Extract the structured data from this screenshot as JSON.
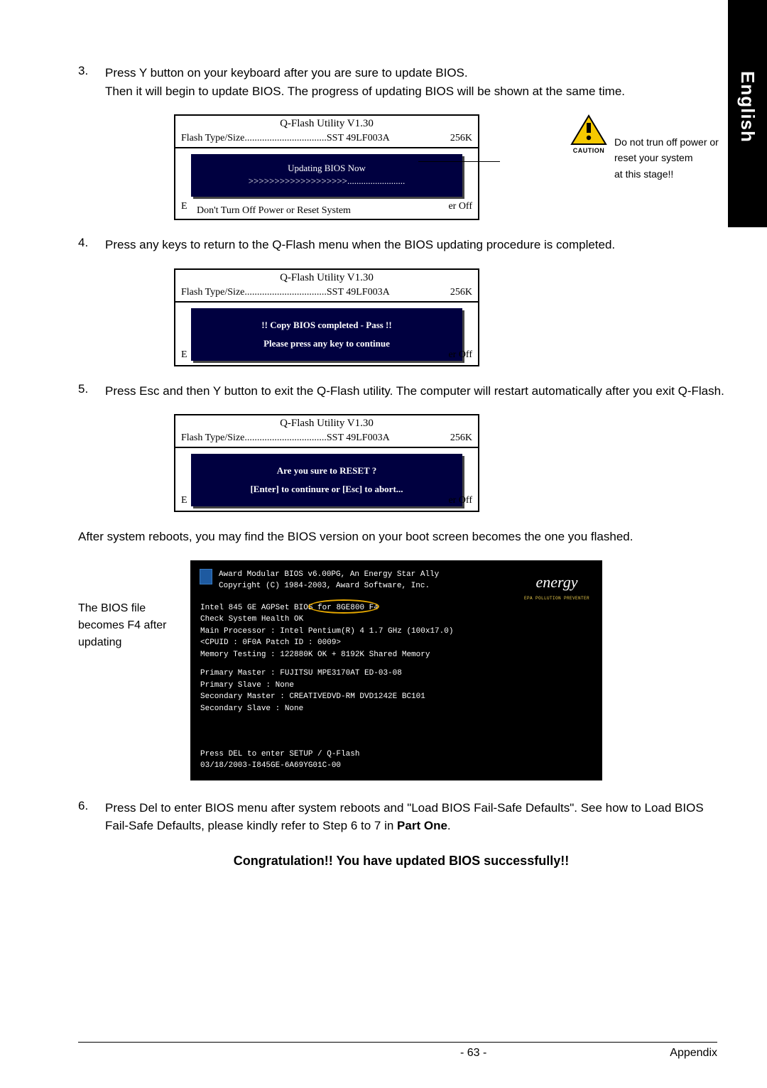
{
  "sidebar": {
    "language": "English"
  },
  "steps": {
    "s3": {
      "num": "3.",
      "text1": "Press Y button on your keyboard after you are sure to update BIOS.",
      "text2": "Then it will begin to update BIOS. The progress of updating BIOS will be shown at the same time."
    },
    "s4": {
      "num": "4.",
      "text": "Press any keys to return to the Q-Flash menu when the BIOS updating procedure is completed."
    },
    "s5": {
      "num": "5.",
      "text": "Press Esc and then Y button to exit the Q-Flash utility. The computer will restart automatically after you exit Q-Flash."
    },
    "s6": {
      "num": "6.",
      "text": "Press Del to enter BIOS menu after system reboots and \"Load BIOS Fail-Safe Defaults\". See how to Load BIOS Fail-Safe Defaults, please kindly refer to Step 6 to 7 in Part One."
    }
  },
  "qflash": {
    "title": "Q-Flash Utility V1.30",
    "flash_label": "Flash Type/Size.................................SST 49LF003A",
    "size": "256K",
    "footer_left": "E",
    "footer_right": "er Off",
    "box1": {
      "line1": "Updating BIOS Now",
      "line2": ">>>>>>>>>>>>>>>>>>>.........................",
      "footer_full": "Don't Turn Off Power or Reset System"
    },
    "box2": {
      "line1": "!! Copy BIOS completed - Pass !!",
      "line2": "Please press any key to continue"
    },
    "box3": {
      "line1": "Are you sure to RESET ?",
      "line2": "[Enter] to continure or [Esc] to abort..."
    }
  },
  "caution": {
    "label": "CAUTION",
    "note1": "Do not trun off power or",
    "note2": "reset your system",
    "note3": "at this stage!!"
  },
  "after_reboot": "After system reboots, you may find the BIOS version on your boot screen becomes the one you flashed.",
  "boot_label": "The BIOS file becomes F4 after updating",
  "boot": {
    "l1": "Award Modular BIOS v6.00PG, An Energy Star Ally",
    "l2": "Copyright (C) 1984-2003, Award Software, Inc.",
    "l3a": "Intel 845 GE AGPSet BIOS",
    "l3b": "for 8GE800 F4",
    "l4": "Check System Health OK",
    "l5": "Main Processor : Intel Pentium(R) 4  1.7 GHz (100x17.0)",
    "l6": "<CPUID : 0F0A Patch ID : 0009>",
    "l7": "Memory Testing  : 122880K OK + 8192K Shared Memory",
    "l8": "Primary Master : FUJITSU MPE3170AT ED-03-08",
    "l9": "Primary Slave : None",
    "l10": "Secondary Master : CREATIVEDVD-RM DVD1242E BC101",
    "l11": "Secondary Slave : None",
    "l12": "Press DEL to enter SETUP / Q-Flash",
    "l13": "03/18/2003-I845GE-6A69YG01C-00",
    "energy": "energy",
    "energy_sub": "EPA  POLLUTION PREVENTER"
  },
  "congrat": "Congratulation!! You have updated BIOS successfully!!",
  "footer": {
    "page": "- 63 -",
    "section": "Appendix"
  }
}
